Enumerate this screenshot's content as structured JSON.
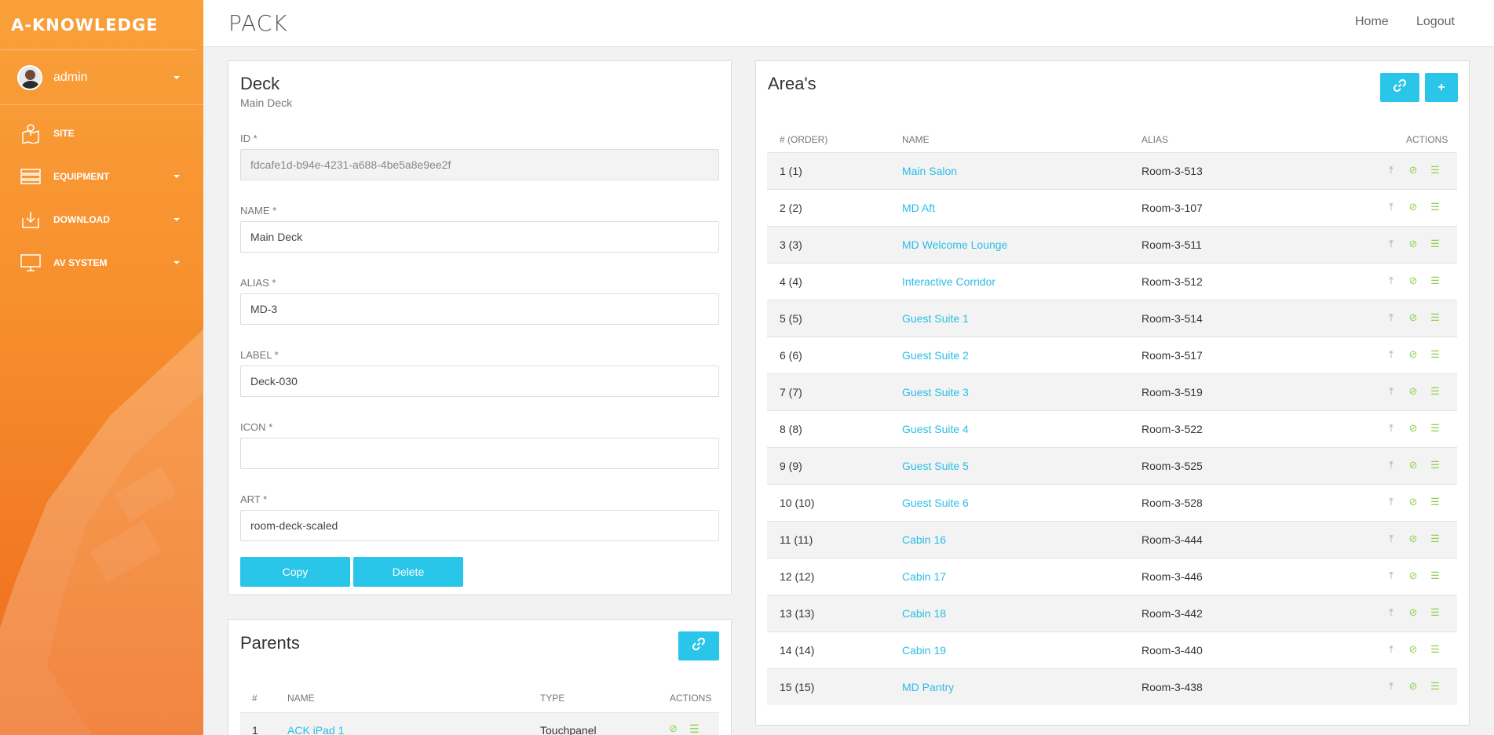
{
  "brand": "A-KNOWLEDGE",
  "logo": "PACK",
  "user": {
    "name": "admin"
  },
  "nav": [
    {
      "label": "SITE",
      "icon": "map-icon",
      "has_caret": false
    },
    {
      "label": "EQUIPMENT",
      "icon": "equipment-icon",
      "has_caret": true
    },
    {
      "label": "DOWNLOAD",
      "icon": "download-icon",
      "has_caret": true
    },
    {
      "label": "AV SYSTEM",
      "icon": "monitor-icon",
      "has_caret": true
    }
  ],
  "topnav": {
    "home": "Home",
    "logout": "Logout"
  },
  "deck": {
    "title": "Deck",
    "subtitle": "Main Deck",
    "fields": {
      "id": {
        "label": "ID *",
        "value": "fdcafe1d-b94e-4231-a688-4be5a8e9ee2f"
      },
      "name": {
        "label": "NAME *",
        "value": "Main Deck"
      },
      "alias": {
        "label": "ALIAS *",
        "value": "MD-3"
      },
      "label": {
        "label": "LABEL *",
        "value": "Deck-030"
      },
      "icon": {
        "label": "ICON *",
        "value": ""
      },
      "art": {
        "label": "ART *",
        "value": "room-deck-scaled"
      }
    },
    "copy_label": "Copy",
    "delete_label": "Delete"
  },
  "parents": {
    "title": "Parents",
    "columns": [
      "#",
      "NAME",
      "TYPE",
      "ACTIONS"
    ],
    "rows": [
      {
        "num": "1",
        "name": "ACK iPad 1",
        "type": "Touchpanel"
      }
    ]
  },
  "areas": {
    "title": "Area's",
    "add_label": "+",
    "columns": [
      "# (ORDER)",
      "NAME",
      "ALIAS",
      "ACTIONS"
    ],
    "rows": [
      {
        "order": "1 (1)",
        "name": "Main Salon",
        "alias": "Room-3-513"
      },
      {
        "order": "2 (2)",
        "name": "MD Aft",
        "alias": "Room-3-107"
      },
      {
        "order": "3 (3)",
        "name": "MD Welcome Lounge",
        "alias": "Room-3-511"
      },
      {
        "order": "4 (4)",
        "name": "Interactive Corridor",
        "alias": "Room-3-512"
      },
      {
        "order": "5 (5)",
        "name": "Guest Suite 1",
        "alias": "Room-3-514"
      },
      {
        "order": "6 (6)",
        "name": "Guest Suite 2",
        "alias": "Room-3-517"
      },
      {
        "order": "7 (7)",
        "name": "Guest Suite 3",
        "alias": "Room-3-519"
      },
      {
        "order": "8 (8)",
        "name": "Guest Suite 4",
        "alias": "Room-3-522"
      },
      {
        "order": "9 (9)",
        "name": "Guest Suite 5",
        "alias": "Room-3-525"
      },
      {
        "order": "10 (10)",
        "name": "Guest Suite 6",
        "alias": "Room-3-528"
      },
      {
        "order": "11 (11)",
        "name": "Cabin 16",
        "alias": "Room-3-444"
      },
      {
        "order": "12 (12)",
        "name": "Cabin 17",
        "alias": "Room-3-446"
      },
      {
        "order": "13 (13)",
        "name": "Cabin 18",
        "alias": "Room-3-442"
      },
      {
        "order": "14 (14)",
        "name": "Cabin 19",
        "alias": "Room-3-440"
      },
      {
        "order": "15 (15)",
        "name": "MD Pantry",
        "alias": "Room-3-438"
      }
    ]
  },
  "colors": {
    "accent": "#29c6ea",
    "link": "#29bde6",
    "action_green": "#8fd14f",
    "sidebar_orange": "#f7902e"
  }
}
